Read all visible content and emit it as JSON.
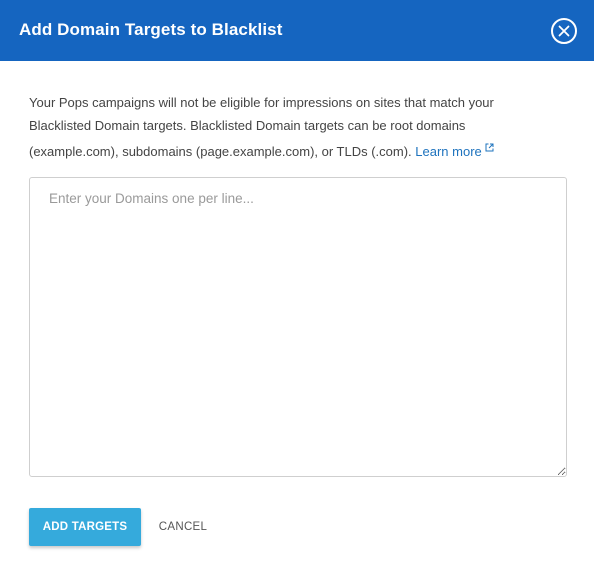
{
  "dialog": {
    "title": "Add Domain Targets to Blacklist",
    "close_icon": "close-circle-icon"
  },
  "description": {
    "text": "Your Pops campaigns will not be eligible for impressions on sites that match your Blacklisted Domain targets. Blacklisted Domain targets can be root domains (example.com), subdomains (page.example.com), or TLDs (.com). ",
    "link_label": "Learn more",
    "link_icon": "external-link-icon"
  },
  "domains_input": {
    "value": "",
    "placeholder": "Enter your Domains one per line..."
  },
  "actions": {
    "add_label": "ADD TARGETS",
    "cancel_label": "CANCEL"
  },
  "colors": {
    "header": "#1565c0",
    "primary_button": "#35aadc",
    "link": "#1e73be"
  }
}
